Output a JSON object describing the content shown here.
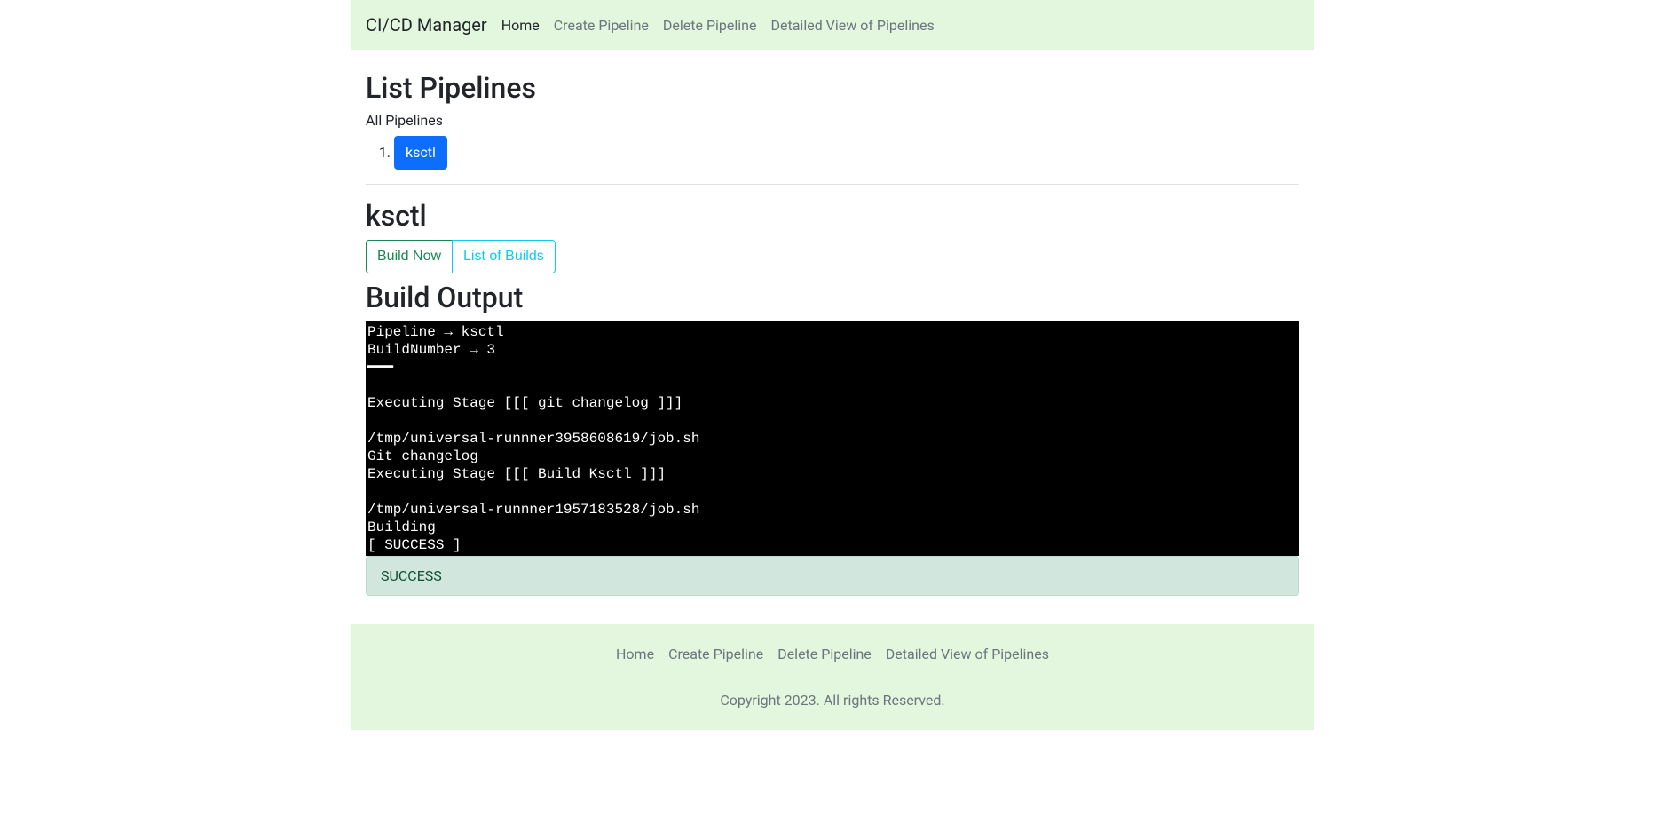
{
  "navbar": {
    "brand": "CI/CD Manager",
    "links": [
      {
        "label": "Home",
        "active": true
      },
      {
        "label": "Create Pipeline",
        "active": false
      },
      {
        "label": "Delete Pipeline",
        "active": false
      },
      {
        "label": "Detailed View of Pipelines",
        "active": false
      }
    ]
  },
  "main": {
    "list_title": "List Pipelines",
    "list_subtitle": "All Pipelines",
    "pipelines": [
      {
        "name": "ksctl"
      }
    ],
    "selected_pipeline": "ksctl",
    "build_now_label": "Build Now",
    "list_builds_label": "List of Builds",
    "build_output_title": "Build Output",
    "console_output": "Pipeline → ksctl\nBuildNumber → 3\n━━━\n\nExecuting Stage [[[ git changelog ]]]\n\n/tmp/universal-runnner3958608619/job.sh\nGit changelog\nExecuting Stage [[[ Build Ksctl ]]]\n\n/tmp/universal-runnner1957183528/job.sh\nBuilding\n[ SUCCESS ]",
    "status_text": "SUCCESS"
  },
  "footer": {
    "links": [
      {
        "label": "Home"
      },
      {
        "label": "Create Pipeline"
      },
      {
        "label": "Delete Pipeline"
      },
      {
        "label": "Detailed View of Pipelines"
      }
    ],
    "copyright": "Copyright 2023. All rights Reserved."
  }
}
